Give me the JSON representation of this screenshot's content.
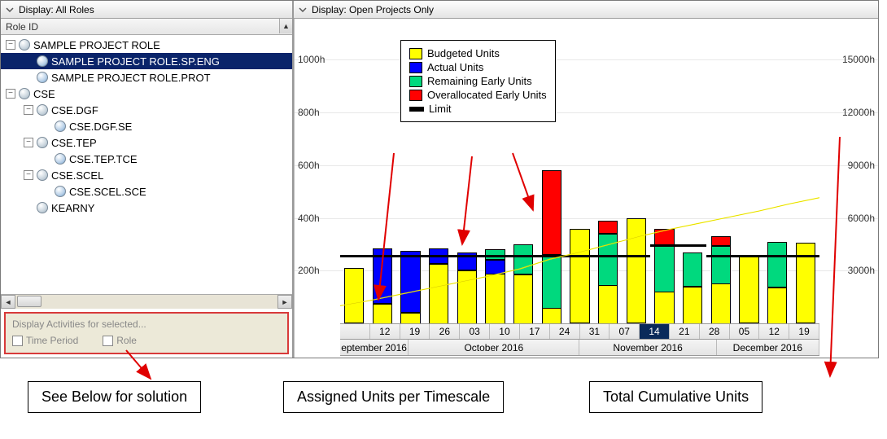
{
  "left": {
    "display_label": "Display: All Roles",
    "column_header": "Role ID",
    "tree": [
      {
        "level": 0,
        "exp": "-",
        "icon": "role",
        "label": "SAMPLE PROJECT ROLE",
        "selected": false
      },
      {
        "level": 1,
        "exp": "",
        "icon": "sub",
        "label": "SAMPLE PROJECT ROLE.SP.ENG",
        "selected": true
      },
      {
        "level": 1,
        "exp": "",
        "icon": "sub",
        "label": "SAMPLE PROJECT ROLE.PROT",
        "selected": false
      },
      {
        "level": 0,
        "exp": "-",
        "icon": "role",
        "label": "CSE",
        "selected": false
      },
      {
        "level": 1,
        "exp": "-",
        "icon": "role",
        "label": "CSE.DGF",
        "selected": false
      },
      {
        "level": 2,
        "exp": "",
        "icon": "sub",
        "label": "CSE.DGF.SE",
        "selected": false
      },
      {
        "level": 1,
        "exp": "-",
        "icon": "role",
        "label": "CSE.TEP",
        "selected": false
      },
      {
        "level": 2,
        "exp": "",
        "icon": "sub",
        "label": "CSE.TEP.TCE",
        "selected": false
      },
      {
        "level": 1,
        "exp": "-",
        "icon": "role",
        "label": "CSE.SCEL",
        "selected": false
      },
      {
        "level": 2,
        "exp": "",
        "icon": "sub",
        "label": "CSE.SCEL.SCE",
        "selected": false
      },
      {
        "level": 1,
        "exp": "",
        "icon": "role",
        "label": "KEARNY",
        "selected": false
      }
    ],
    "filter_title": "Display Activities for selected...",
    "chk_time": "Time Period",
    "chk_role": "Role"
  },
  "right": {
    "display_label": "Display: Open Projects Only"
  },
  "legend": {
    "budgeted": "Budgeted Units",
    "actual": "Actual Units",
    "remaining": "Remaining Early Units",
    "over": "Overallocated Early Units",
    "limit": "Limit"
  },
  "callouts": {
    "a": "See Below for solution",
    "b": "Assigned Units per Timescale",
    "c": "Total Cumulative Units"
  },
  "chart_data": {
    "type": "bar",
    "ylabel_left": "h",
    "ylabel_right": "h",
    "y_left_ticks": [
      200,
      400,
      600,
      800,
      1000
    ],
    "y_right_ticks": [
      3000,
      6000,
      9000,
      12000,
      15000
    ],
    "y_left_max": 1100,
    "y_right_max": 16500,
    "limit": 260,
    "months": [
      {
        "label": "eptember 2016",
        "span": 2
      },
      {
        "label": "October 2016",
        "span": 5
      },
      {
        "label": "November 2016",
        "span": 4
      },
      {
        "label": "December 2016",
        "span": 3
      }
    ],
    "days": [
      "",
      "12",
      "19",
      "26",
      "03",
      "10",
      "17",
      "24",
      "31",
      "07",
      "14",
      "21",
      "28",
      "05",
      "12",
      "19"
    ],
    "highlight_day_index": 10,
    "series_colors": {
      "budgeted": "#ffff00",
      "actual": "#0000ff",
      "remaining": "#00d97e",
      "over": "#ff0000"
    },
    "stacks": [
      {
        "budgeted": 210,
        "actual": 0,
        "remaining": 0,
        "over": 0
      },
      {
        "budgeted": 75,
        "actual": 210,
        "remaining": 0,
        "over": 0
      },
      {
        "budgeted": 40,
        "actual": 235,
        "remaining": 0,
        "over": 0
      },
      {
        "budgeted": 225,
        "actual": 60,
        "remaining": 0,
        "over": 0
      },
      {
        "budgeted": 200,
        "actual": 70,
        "remaining": 0,
        "over": 0
      },
      {
        "budgeted": 190,
        "actual": 50,
        "remaining": 40,
        "over": 0
      },
      {
        "budgeted": 185,
        "actual": 0,
        "remaining": 115,
        "over": 0
      },
      {
        "budgeted": 60,
        "actual": 0,
        "remaining": 200,
        "over": 320
      },
      {
        "budgeted": 360,
        "actual": 0,
        "remaining": 0,
        "over": 0
      },
      {
        "budgeted": 145,
        "actual": 0,
        "remaining": 195,
        "over": 50
      },
      {
        "budgeted": 400,
        "actual": 0,
        "remaining": 0,
        "over": 0
      },
      {
        "budgeted": 120,
        "actual": 0,
        "remaining": 175,
        "over": 65
      },
      {
        "budgeted": 140,
        "actual": 0,
        "remaining": 130,
        "over": 0
      },
      {
        "budgeted": 150,
        "actual": 0,
        "remaining": 145,
        "over": 35
      },
      {
        "budgeted": 260,
        "actual": 0,
        "remaining": 0,
        "over": 0
      },
      {
        "budgeted": 135,
        "actual": 0,
        "remaining": 175,
        "over": 0
      },
      {
        "budgeted": 305,
        "actual": 0,
        "remaining": 0,
        "over": 0
      }
    ],
    "limit_segments": [
      {
        "from": 0,
        "to": 11,
        "value": 260
      },
      {
        "from": 11,
        "to": 13,
        "value": 300
      },
      {
        "from": 13,
        "to": 17,
        "value": 260
      }
    ],
    "cumulative": [
      1000,
      1300,
      1650,
      2000,
      2350,
      2700,
      3100,
      3650,
      4050,
      4500,
      4950,
      5350,
      5700,
      6050,
      6400,
      6800,
      7150
    ]
  }
}
